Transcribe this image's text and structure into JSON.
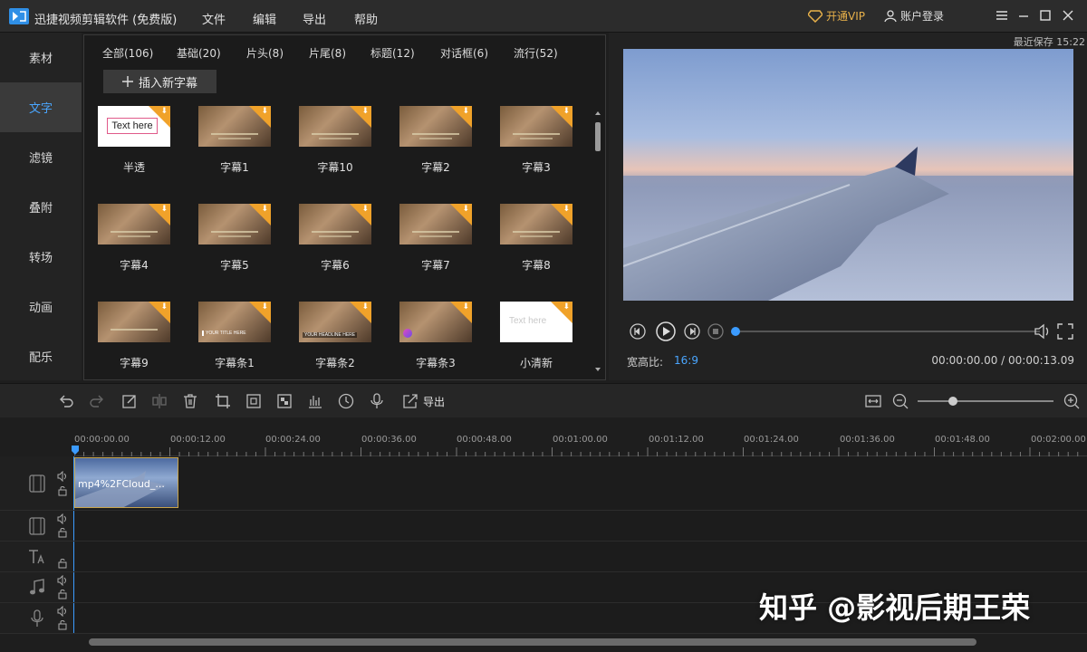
{
  "app": {
    "title": "迅捷视频剪辑软件 (免费版)",
    "menu": [
      "文件",
      "编辑",
      "导出",
      "帮助"
    ],
    "vip": "开通VIP",
    "account": "账户登录"
  },
  "sidebar": {
    "items": [
      "素材",
      "文字",
      "滤镜",
      "叠附",
      "转场",
      "动画",
      "配乐"
    ],
    "active": "文字"
  },
  "library": {
    "categories": [
      "全部(106)",
      "基础(20)",
      "片头(8)",
      "片尾(8)",
      "标题(12)",
      "对话框(6)",
      "流行(52)"
    ],
    "insert_button": "插入新字幕",
    "tiles": [
      {
        "label": "半透",
        "thumb_text": "Text here"
      },
      {
        "label": "字幕1"
      },
      {
        "label": "字幕10"
      },
      {
        "label": "字幕2"
      },
      {
        "label": "字幕3"
      },
      {
        "label": "字幕4"
      },
      {
        "label": "字幕5"
      },
      {
        "label": "字幕6"
      },
      {
        "label": "字幕7"
      },
      {
        "label": "字幕8"
      },
      {
        "label": "字幕9"
      },
      {
        "label": "字幕条1",
        "thumb_text": "YOUR TITLE HERE"
      },
      {
        "label": "字幕条2",
        "thumb_text": "YOUR HEADLINE HERE"
      },
      {
        "label": "字幕条3"
      },
      {
        "label": "小清新",
        "thumb_text": "Text here"
      }
    ]
  },
  "preview": {
    "last_saved": "最近保存 15:22",
    "aspect_label": "宽高比:",
    "aspect_value": "16:9",
    "timecode": "00:00:00.00 / 00:00:13.09",
    "progress": 0
  },
  "timeline": {
    "export_label": "导出",
    "ruler": [
      "00:00:00.00",
      "00:00:12.00",
      "00:00:24.00",
      "00:00:36.00",
      "00:00:48.00",
      "00:01:00.00",
      "00:01:12.00",
      "00:01:24.00",
      "00:01:36.00",
      "00:01:48.00",
      "00:02:00.00"
    ],
    "clip_name": "mp4%2FCloud_..."
  },
  "watermark": "知乎 @影视后期王荣"
}
